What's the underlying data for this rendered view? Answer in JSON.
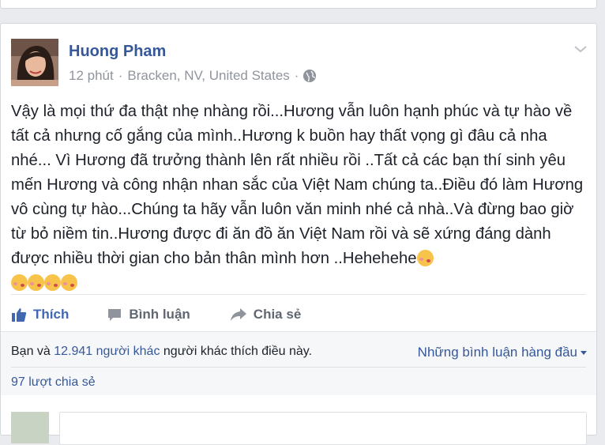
{
  "post": {
    "author": "Huong Pham",
    "time": "12 phút",
    "separator": "·",
    "location": "Bracken, NV, United States",
    "privacy_icon": "globe-icon",
    "text": "Vậy là mọi thứ đa thật nhẹ nhàng rồi...Hương vẫn luôn hạnh phúc và tự hào về tất cả nhưng cố gắng của mình..Hương k buồn hay thất vọng gì đâu cả nha nhé... Vì Hương đã trưởng thành lên rất nhiều rồi ..Tất cả các bạn thí sinh yêu mến Hương và công nhận nhan sắc của Việt Nam chúng ta..Điều đó làm Hương vô cùng tự hào...Chúng ta hãy vẫn luôn văn minh nhé cả nhà..Và đừng bao giờ từ bỏ niềm tin..Hương được đi ăn đồ ăn Việt Nam rồi và sẽ xứng đáng dành được nhiều thời gian cho bản thân mình hơn ..Hehehehe",
    "emoji_icon": "kiss-emoji-icon",
    "emoji_count": 5
  },
  "actions": {
    "like": "Thích",
    "comment": "Bình luận",
    "share": "Chia sẻ"
  },
  "social": {
    "likes_prefix": "Bạn và",
    "likes_link": "12.941 người khác",
    "likes_suffix": "người khác thích điều này.",
    "top_comments": "Những bình luận hàng đầu",
    "shares": "97 lượt chia sẻ"
  },
  "colors": {
    "link": "#365899",
    "like_active": "#4267b2",
    "meta": "#90949c"
  }
}
